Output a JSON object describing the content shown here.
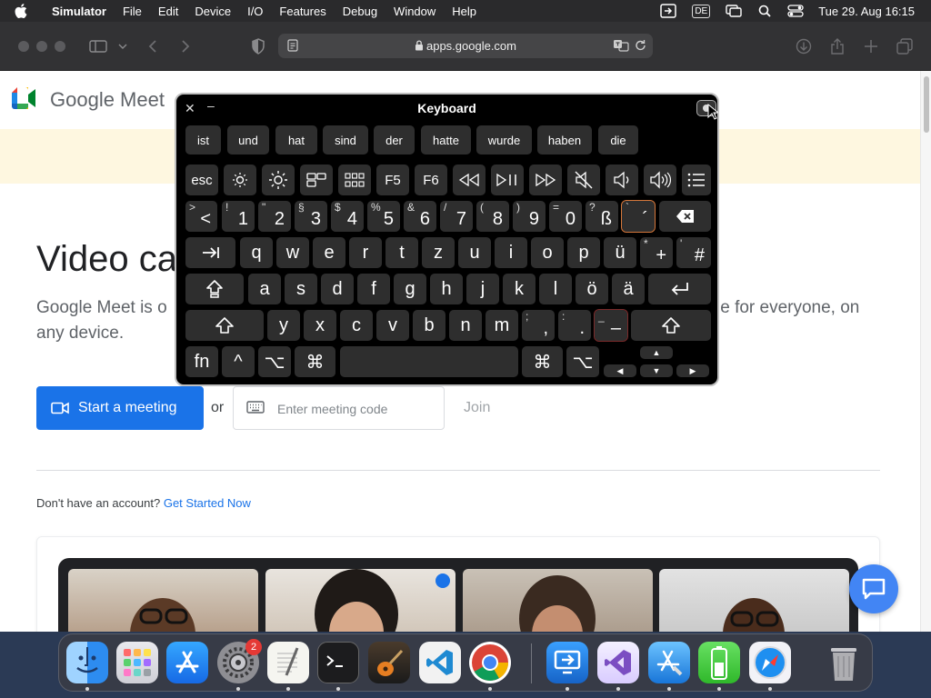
{
  "menubar": {
    "items": [
      "Simulator",
      "File",
      "Edit",
      "Device",
      "I/O",
      "Features",
      "Debug",
      "Window",
      "Help"
    ],
    "input_source": "DE",
    "clock": "Tue 29. Aug  16:15"
  },
  "browser": {
    "url": "apps.google.com"
  },
  "page": {
    "brand": "Google Meet",
    "hero_title": "Video ca",
    "hero_sub_left": "Google Meet is o",
    "hero_sub_right": "le for everyone, on",
    "hero_sub_line2": "any device.",
    "start_button": "Start a meeting",
    "or_text": "or",
    "code_placeholder": "Enter meeting code",
    "join": "Join",
    "account_text": "Don't have an account?",
    "account_link": "Get Started Now"
  },
  "keyboard": {
    "title": "Keyboard",
    "close": "✕",
    "minimize": "–",
    "predictions": [
      "ist",
      "und",
      "hat",
      "sind",
      "der",
      "hatte",
      "wurde",
      "haben",
      "die"
    ],
    "function_row": {
      "esc": "esc",
      "f5": "F5",
      "f6": "F6",
      "icons": [
        "brightness-down-icon",
        "brightness-up-icon",
        "mission-control-icon",
        "launchpad-icon",
        "rewind-icon",
        "play-pause-icon",
        "fast-forward-icon",
        "mute-icon",
        "volume-down-icon",
        "volume-up-icon",
        "list-icon"
      ]
    },
    "number_row": [
      {
        "sec": ">",
        "pri": "<"
      },
      {
        "sec": "!",
        "pri": "1"
      },
      {
        "sec": "\"",
        "pri": "2"
      },
      {
        "sec": "§",
        "pri": "3"
      },
      {
        "sec": "$",
        "pri": "4"
      },
      {
        "sec": "%",
        "pri": "5"
      },
      {
        "sec": "&",
        "pri": "6"
      },
      {
        "sec": "/",
        "pri": "7"
      },
      {
        "sec": "(",
        "pri": "8"
      },
      {
        "sec": ")",
        "pri": "9"
      },
      {
        "sec": "=",
        "pri": "0"
      },
      {
        "sec": "?",
        "pri": "ß"
      },
      {
        "sec": "`",
        "pri": "´"
      }
    ],
    "row_q": [
      "q",
      "w",
      "e",
      "r",
      "t",
      "z",
      "u",
      "i",
      "o",
      "p",
      "ü"
    ],
    "row_q_extra": [
      {
        "sec": "*",
        "pri": "+"
      },
      {
        "sec": "'",
        "pri": "#"
      }
    ],
    "row_a": [
      "a",
      "s",
      "d",
      "f",
      "g",
      "h",
      "j",
      "k",
      "l",
      "ö",
      "ä"
    ],
    "row_y": [
      "y",
      "x",
      "c",
      "v",
      "b",
      "n",
      "m"
    ],
    "row_y_extra": [
      {
        "sec": ";",
        "pri": ","
      },
      {
        "sec": ":",
        "pri": "."
      },
      {
        "sec": "_",
        "pri": "–"
      }
    ],
    "bottom": {
      "fn": "fn",
      "ctrl": "^",
      "option": "⌥",
      "cmd": "⌘"
    },
    "arrows": {
      "up": "▲",
      "left": "◀",
      "down": "▼",
      "right": "▶"
    }
  },
  "dock": {
    "apps": [
      "Finder",
      "Launchpad",
      "App Store",
      "System Settings",
      "TextEdit",
      "Terminal",
      "Instruments",
      "Visual Studio Code",
      "Google Chrome",
      "Microsoft Remote Desktop",
      "Visual Studio",
      "Xcode",
      "Battery Monitor",
      "Safari",
      "Trash"
    ],
    "settings_badge": "2"
  }
}
